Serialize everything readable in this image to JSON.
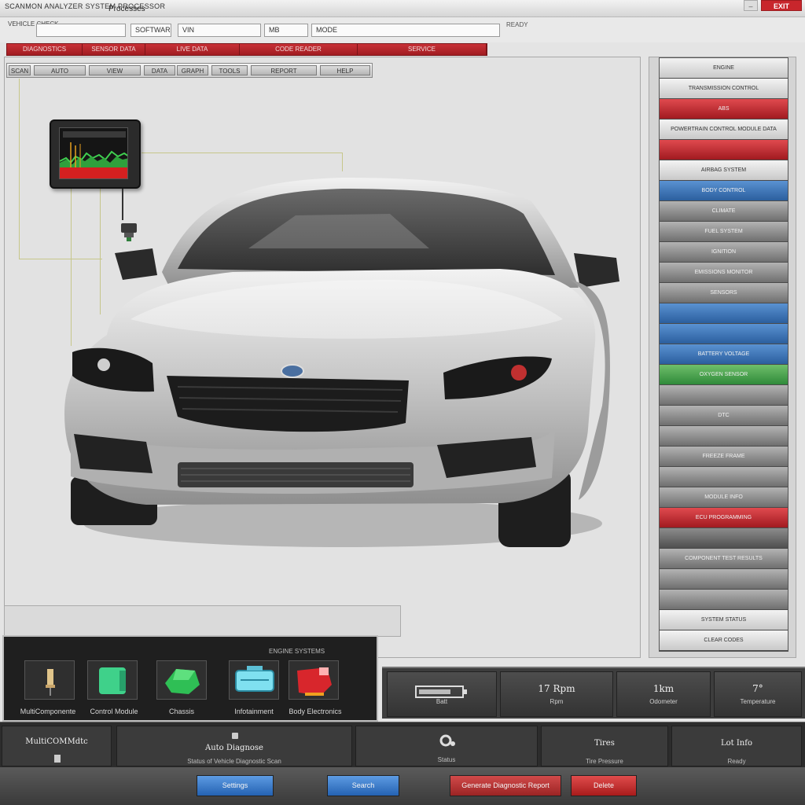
{
  "window": {
    "app_title": "SCANMON ANALYZER SYSTEM PROCESSOR",
    "tab_label": "Processes",
    "min_label": "–",
    "close_label": "EXIT"
  },
  "filters": {
    "caption": "VEHICLE CHECK",
    "field1": "",
    "field2": "SOFTWARE",
    "field3": "VIN",
    "field4": "MB",
    "field5": "MODE",
    "note": "READY"
  },
  "red_tabs": [
    "DIAGNOSTICS",
    "SENSOR DATA",
    "LIVE DATA",
    "CODE READER",
    "SERVICE"
  ],
  "toolbar": [
    "SCAN",
    "AUTO",
    "VIEW",
    "DATA",
    "GRAPH",
    "TOOLS",
    "REPORT",
    "HELP"
  ],
  "categories": [
    {
      "label": "ENGINE",
      "style": "light"
    },
    {
      "label": "TRANSMISSION CONTROL",
      "style": "light"
    },
    {
      "label": "ABS",
      "style": "red"
    },
    {
      "label": "POWERTRAIN CONTROL MODULE DATA",
      "style": "light"
    },
    {
      "label": "",
      "style": "red"
    },
    {
      "label": "AIRBAG SYSTEM",
      "style": "light"
    },
    {
      "label": "BODY CONTROL",
      "style": "blue"
    },
    {
      "label": "CLIMATE",
      "style": "default"
    },
    {
      "label": "FUEL SYSTEM",
      "style": "default"
    },
    {
      "label": "IGNITION",
      "style": "default"
    },
    {
      "label": "EMISSIONS MONITOR",
      "style": "default"
    },
    {
      "label": "SENSORS",
      "style": "default"
    },
    {
      "label": "",
      "style": "blue"
    },
    {
      "label": "",
      "style": "blue"
    },
    {
      "label": "BATTERY VOLTAGE",
      "style": "blue"
    },
    {
      "label": "OXYGEN SENSOR",
      "style": "green"
    },
    {
      "label": "",
      "style": "default"
    },
    {
      "label": "DTC",
      "style": "default"
    },
    {
      "label": "",
      "style": "default"
    },
    {
      "label": "FREEZE FRAME",
      "style": "default"
    },
    {
      "label": "",
      "style": "default"
    },
    {
      "label": "MODULE INFO",
      "style": "default"
    },
    {
      "label": "ECU PROGRAMMING",
      "style": "red"
    },
    {
      "label": "",
      "style": "darkrow"
    },
    {
      "label": "COMPONENT TEST RESULTS",
      "style": "default"
    },
    {
      "label": "",
      "style": "default"
    },
    {
      "label": "",
      "style": "default"
    },
    {
      "label": "SYSTEM STATUS",
      "style": "light"
    },
    {
      "label": "CLEAR CODES",
      "style": "light"
    }
  ],
  "modules": {
    "caption": "ENGINE SYSTEMS",
    "items": [
      {
        "label": "MultiComponente",
        "icon": "sensor-icon",
        "color": "#e0c48a"
      },
      {
        "label": "Control Module",
        "icon": "engine-icon",
        "color": "#3fd18a"
      },
      {
        "label": "Chassis",
        "icon": "chassis-icon",
        "color": "#2fbf55"
      },
      {
        "label": "Infotainment",
        "icon": "dashboard-icon",
        "color": "#7fe0f0"
      },
      {
        "label": "Body Electronics",
        "icon": "body-icon",
        "color": "#d8262c"
      }
    ]
  },
  "stats": [
    {
      "value": "",
      "label": "Batt"
    },
    {
      "value": "17 Rpm",
      "label": "Rpm"
    },
    {
      "value": "1km",
      "label": "Odometer"
    },
    {
      "value": "7°",
      "label": "Temperature"
    }
  ],
  "info": [
    {
      "title": "MultiCOMMdtc",
      "sub": ""
    },
    {
      "title": "Auto Diagnose",
      "sub": "Status of Vehicle Diagnostic Scan"
    },
    {
      "title": "",
      "sub": "Status"
    },
    {
      "title": "Tires",
      "sub": "Tire Pressure"
    },
    {
      "title": "Lot Info",
      "sub": "Ready"
    }
  ],
  "actions": [
    {
      "label": "Settings",
      "style": "blue"
    },
    {
      "label": "Search",
      "style": "blue"
    },
    {
      "label": "Generate Diagnostic Report",
      "style": "red2"
    },
    {
      "label": "Delete",
      "style": "red"
    }
  ],
  "colors": {
    "accent_red": "#c8262c",
    "accent_blue": "#2f6fbf",
    "accent_green": "#3a9a45"
  }
}
